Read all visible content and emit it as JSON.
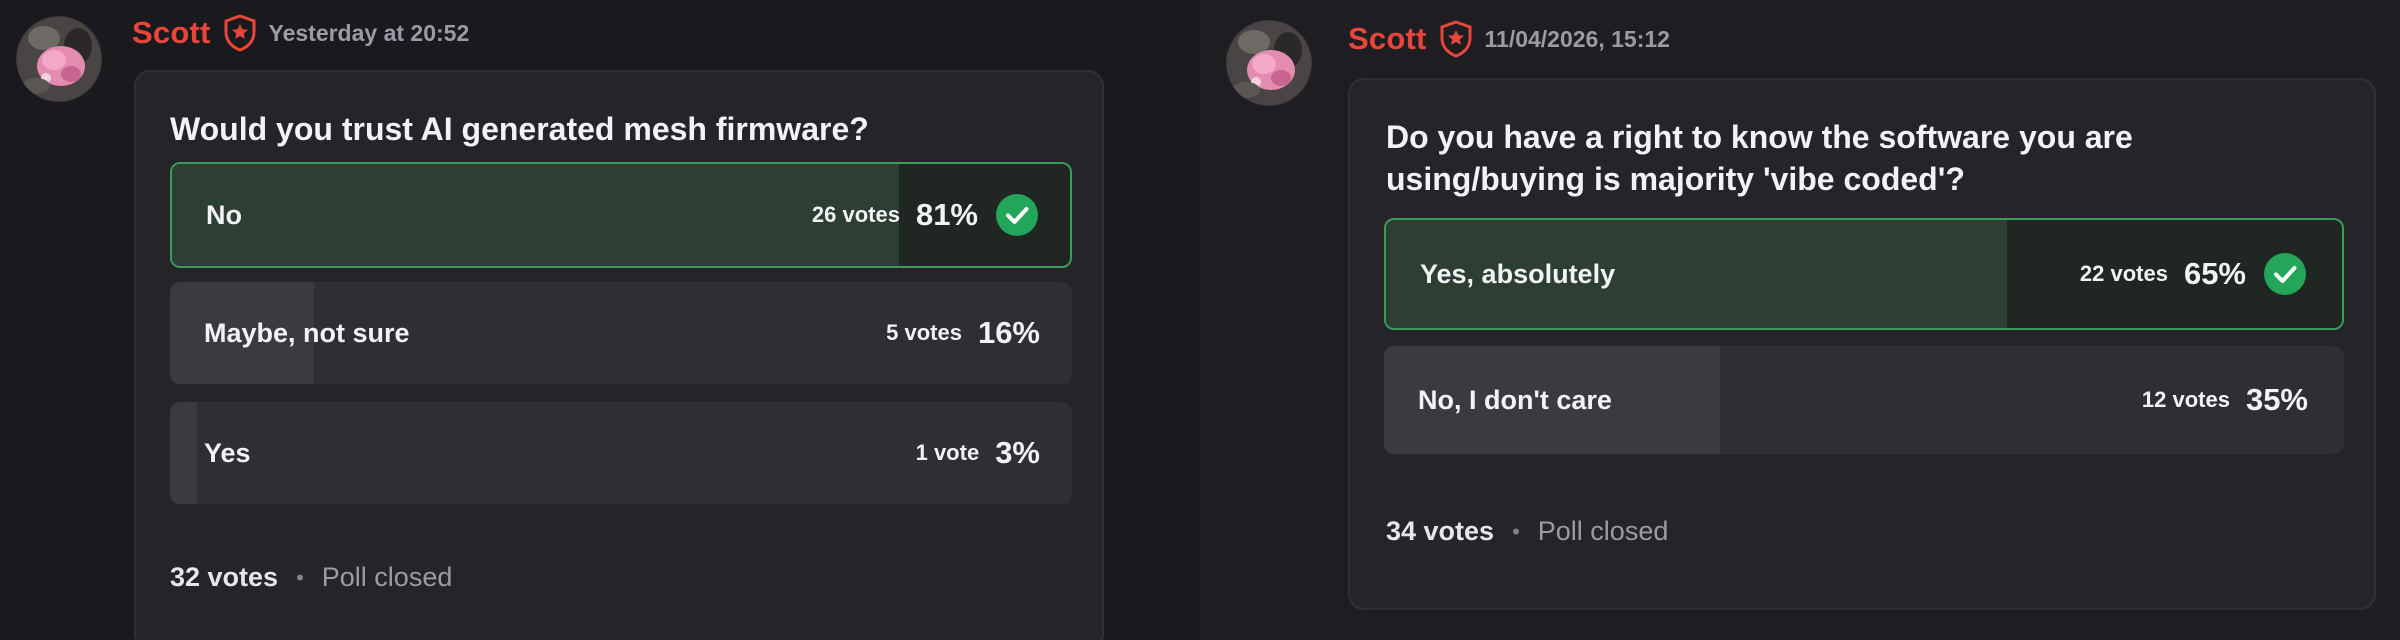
{
  "polls": [
    {
      "author": "Scott",
      "timestamp": "Yesterday at 20:52",
      "question": "Would you trust AI generated mesh firmware?",
      "answers": [
        {
          "label": "No",
          "votes": "26 votes",
          "percent": "81%",
          "fraction": 0.81,
          "winner": true
        },
        {
          "label": "Maybe, not sure",
          "votes": "5 votes",
          "percent": "16%",
          "fraction": 0.16,
          "winner": false
        },
        {
          "label": "Yes",
          "votes": "1 vote",
          "percent": "3%",
          "fraction": 0.03,
          "winner": false
        }
      ],
      "total_votes": "32 votes",
      "status": "Poll closed"
    },
    {
      "author": "Scott",
      "timestamp": "11/04/2026, 15:12",
      "question_lines": [
        "Do you have a right to know the software you are",
        "using/buying is majority 'vibe coded'?"
      ],
      "answers": [
        {
          "label": "Yes, absolutely",
          "votes": "22 votes",
          "percent": "65%",
          "fraction": 0.65,
          "winner": true
        },
        {
          "label": "No, I don't care",
          "votes": "12 votes",
          "percent": "35%",
          "fraction": 0.35,
          "winner": false
        }
      ],
      "total_votes": "34 votes",
      "status": "Poll closed"
    }
  ],
  "colors": {
    "username": "#e8463b",
    "winner_border": "#3c9a5c",
    "check": "#23a55a"
  },
  "icons": {
    "role": "shield-star-icon",
    "winner": "check-circle-icon",
    "avatar": "avatar-image"
  }
}
